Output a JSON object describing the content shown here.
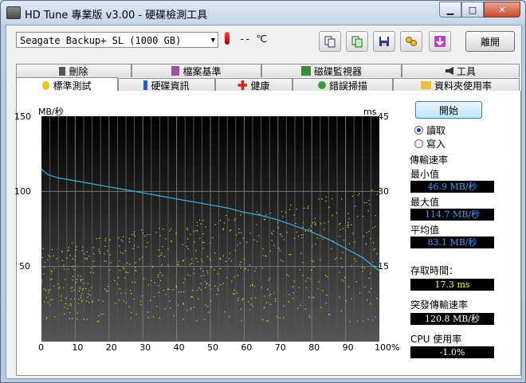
{
  "window": {
    "title": "HD Tune 專業版 v3.00 - 硬碟檢測工具"
  },
  "toolbar": {
    "drive": "Seagate Backup+  SL (1000 GB)",
    "temperature": "-- ℃",
    "exit_label": "離開"
  },
  "tabs_top": [
    {
      "label": "刪除",
      "icon": "trash-icon"
    },
    {
      "label": "檔案基準",
      "icon": "file-benchmark-icon"
    },
    {
      "label": "磁碟監視器",
      "icon": "disk-monitor-icon"
    },
    {
      "label": "工具",
      "icon": "speaker-tool-icon"
    }
  ],
  "tabs_bottom": [
    {
      "label": "標準測試",
      "icon": "bulb-icon",
      "active": true
    },
    {
      "label": "硬碟資訊",
      "icon": "info-icon"
    },
    {
      "label": "健康",
      "icon": "red-cross-icon"
    },
    {
      "label": "錯誤掃描",
      "icon": "magnifier-icon"
    },
    {
      "label": "資料夾使用率",
      "icon": "folder-icon"
    }
  ],
  "controls": {
    "start_label": "開始",
    "read_label": "讀取",
    "write_label": "寫入",
    "selected_mode": "read"
  },
  "stats": {
    "transfer_rate_title": "傳輸速率",
    "min_label": "最小值",
    "min_value": "46.9 MB/秒",
    "max_label": "最大值",
    "max_value": "114.7 MB/秒",
    "avg_label": "平均值",
    "avg_value": "83.1 MB/秒",
    "access_label": "存取時間：",
    "access_value": "17.3 ms",
    "burst_label": "突發傳輸速率",
    "burst_value": "120.8 MB/秒",
    "cpu_label": "CPU 使用率",
    "cpu_value": "-1.0%"
  },
  "colors": {
    "transfer_line": "#3bb0e8",
    "access_points": "#d8d840",
    "chart_bg_top": "#000000",
    "chart_bg_bottom": "#555555"
  },
  "chart_data": {
    "type": "line",
    "ylabel_left": "MB/秒",
    "ylabel_right": "ms",
    "xlim": [
      0,
      100
    ],
    "ylim_left": [
      0,
      150
    ],
    "ylim_right": [
      0,
      45
    ],
    "x_ticks": [
      "0",
      "10",
      "20",
      "30",
      "40",
      "50",
      "60",
      "70",
      "80",
      "90",
      "100%"
    ],
    "y_ticks_left": [
      "150",
      "100",
      "50"
    ],
    "y_ticks_right": [
      "45",
      "30",
      "15"
    ],
    "grid": true,
    "series": [
      {
        "kind": "transfer_rate_MBps",
        "x": [
          0,
          2,
          5,
          10,
          15,
          20,
          25,
          30,
          35,
          40,
          45,
          50,
          55,
          60,
          65,
          70,
          75,
          80,
          85,
          90,
          95,
          100
        ],
        "y": [
          114.7,
          111,
          109,
          107,
          105,
          103,
          101,
          99,
          97,
          95,
          93,
          91,
          89,
          86,
          84,
          81,
          77,
          73,
          68,
          62,
          56,
          47
        ]
      },
      {
        "kind": "access_time_ms",
        "scatter": true,
        "y_range": [
          4,
          31
        ]
      }
    ]
  }
}
